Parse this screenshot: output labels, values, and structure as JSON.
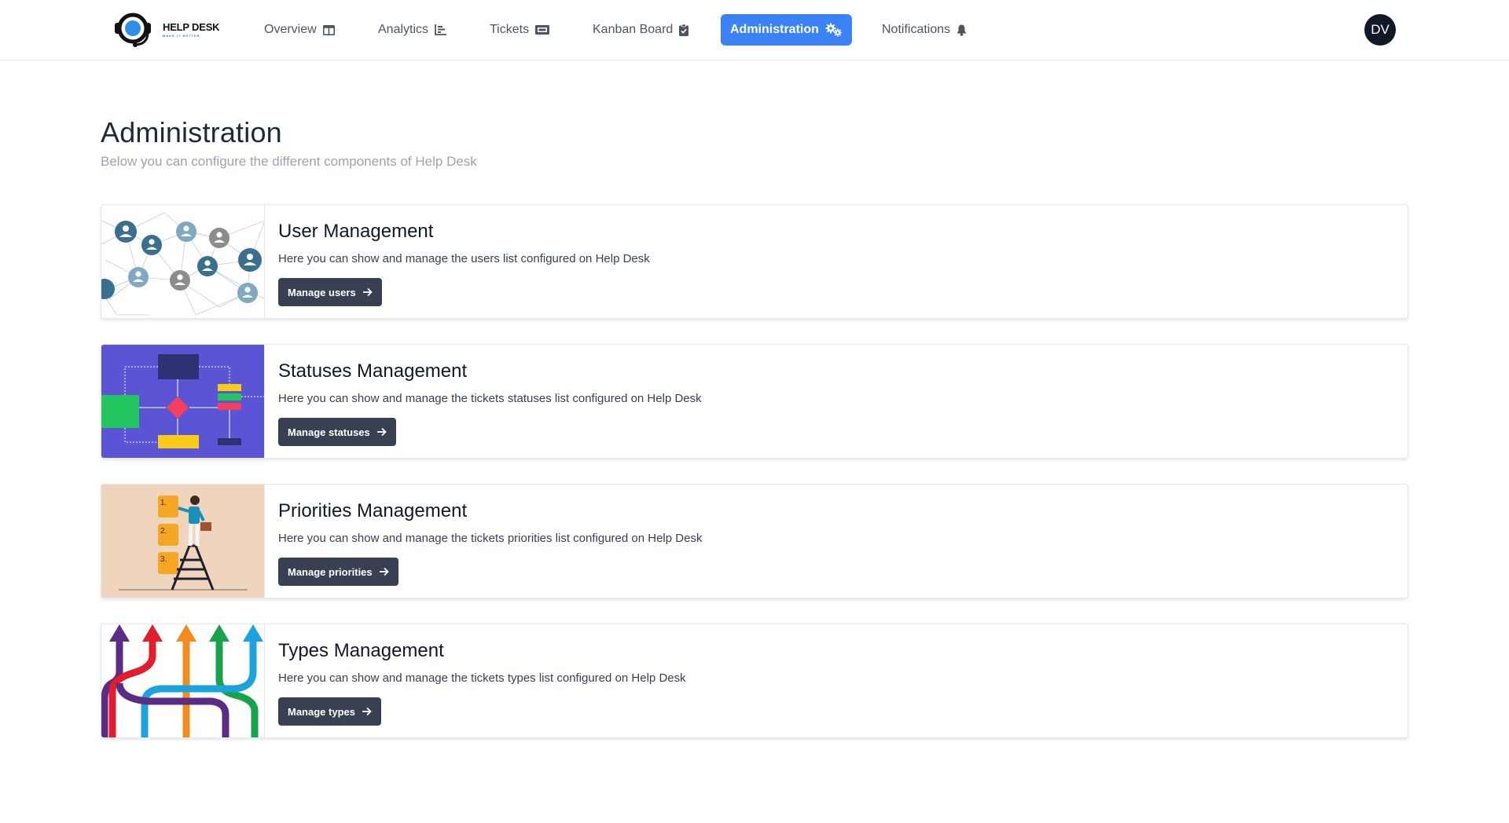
{
  "brand": {
    "title": "HELP DESK",
    "tagline": "MAKE IT BETTER"
  },
  "nav": [
    {
      "label": "Overview",
      "icon": "columns-icon",
      "active": false
    },
    {
      "label": "Analytics",
      "icon": "chart-bar-icon",
      "active": false
    },
    {
      "label": "Tickets",
      "icon": "ticket-icon",
      "active": false
    },
    {
      "label": "Kanban Board",
      "icon": "clipboard-check-icon",
      "active": false
    },
    {
      "label": "Administration",
      "icon": "cogs-icon",
      "active": true
    },
    {
      "label": "Notifications",
      "icon": "bell-icon",
      "active": false
    }
  ],
  "user": {
    "initials": "DV"
  },
  "page": {
    "title": "Administration",
    "subtitle": "Below you can configure the different components of Help Desk"
  },
  "cards": [
    {
      "title": "User Management",
      "description": "Here you can show and manage the users list configured on Help Desk",
      "button": "Manage users"
    },
    {
      "title": "Statuses Management",
      "description": "Here you can show and manage the tickets statuses list configured on Help Desk",
      "button": "Manage statuses"
    },
    {
      "title": "Priorities Management",
      "description": "Here you can show and manage the tickets priorities list configured on Help Desk",
      "button": "Manage priorities"
    },
    {
      "title": "Types Management",
      "description": "Here you can show and manage the tickets types list configured on Help Desk",
      "button": "Manage types"
    }
  ],
  "illustration_labels": {
    "p1": "1.",
    "p2": "2.",
    "p3": "3."
  },
  "colors": {
    "accent": "#3b82f6",
    "button": "#374151",
    "avatar": "#111827"
  }
}
